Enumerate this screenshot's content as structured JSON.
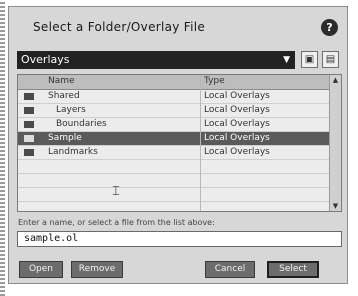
{
  "dialog": {
    "title": "Select a Folder/Overlay File",
    "help_icon": "?"
  },
  "folder": {
    "selected": "Overlays"
  },
  "toolbar": {
    "new_folder_icon": "folder-icon",
    "delete_icon": "trash-icon"
  },
  "list": {
    "headers": [
      "Name",
      "Type"
    ],
    "rows": [
      {
        "name": "Shared",
        "type": "Local Overlays",
        "selected": false
      },
      {
        "name": "Layers",
        "type": "Local Overlays",
        "selected": false
      },
      {
        "name": "Boundaries",
        "type": "Local Overlays",
        "selected": false
      },
      {
        "name": "Sample",
        "type": "Local Overlays",
        "selected": true
      },
      {
        "name": "Landmarks",
        "type": "Local Overlays",
        "selected": false
      }
    ]
  },
  "hint_text": "Enter a name, or select a file from the list above:",
  "filename": "sample.ol",
  "buttons": {
    "open": "Open",
    "remove": "Remove",
    "cancel": "Cancel",
    "select": "Select"
  }
}
